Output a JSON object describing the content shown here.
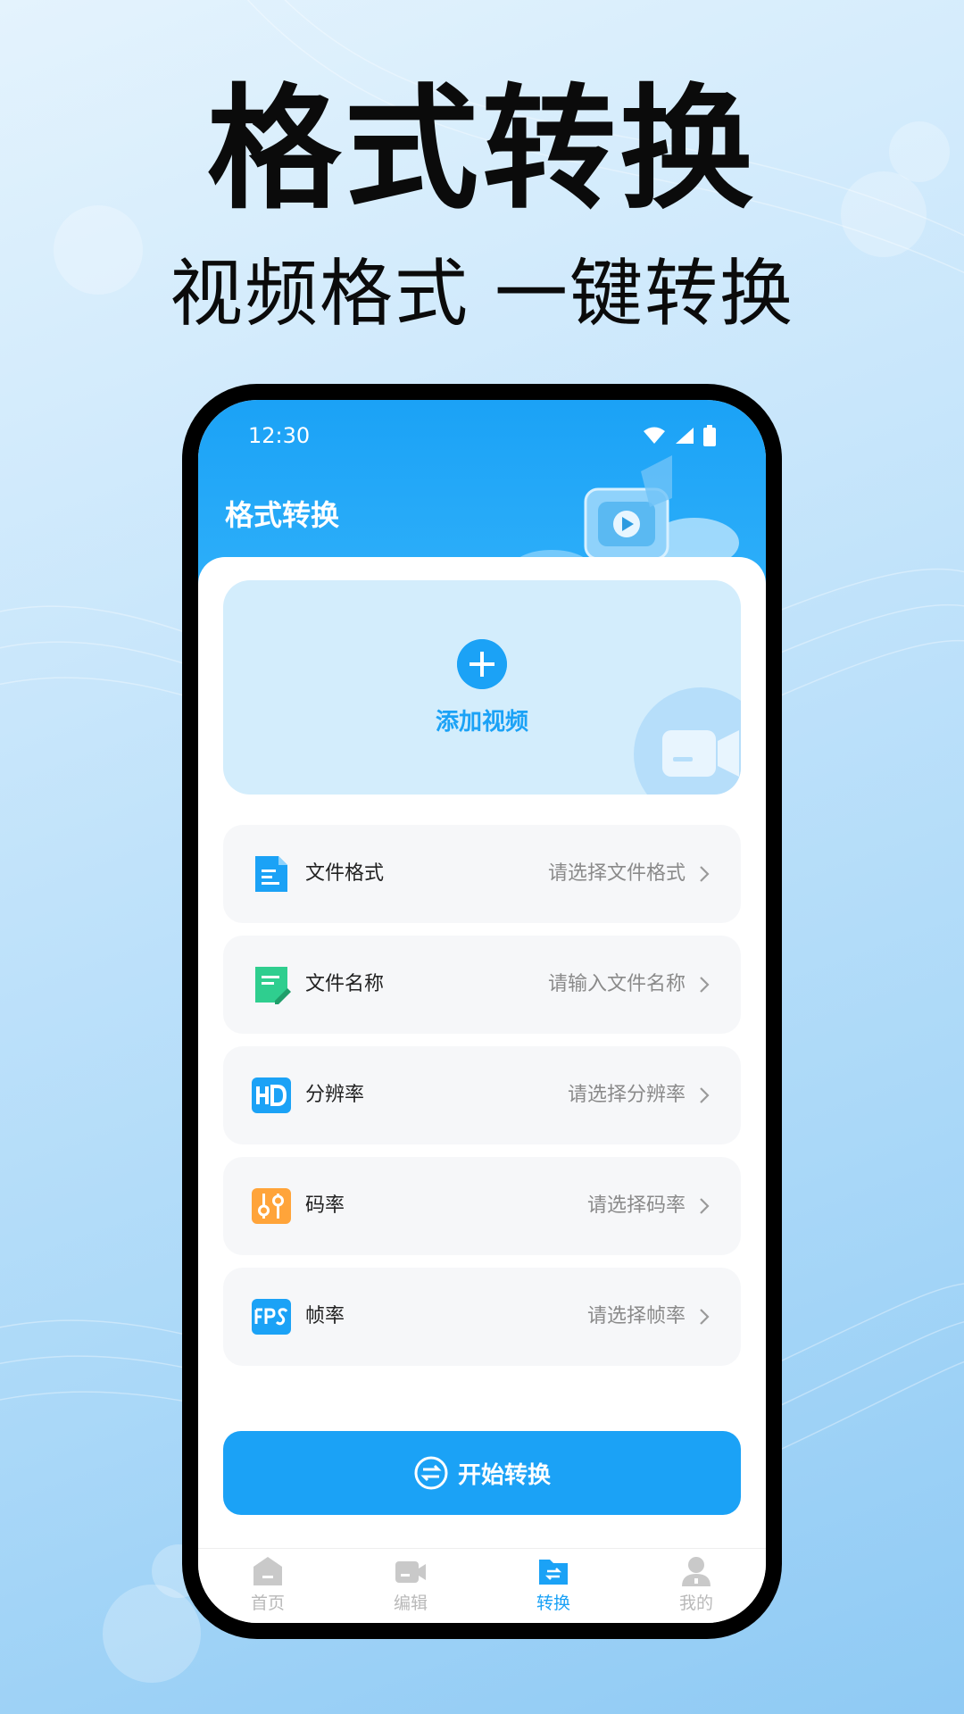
{
  "promo": {
    "title": "格式转换",
    "subtitle": "视频格式 一键转换"
  },
  "status_bar": {
    "time": "12:30"
  },
  "header": {
    "title": "格式转换"
  },
  "add_video": {
    "label": "添加视频"
  },
  "settings": [
    {
      "icon": "document-icon",
      "label": "文件格式",
      "value": "请选择文件格式"
    },
    {
      "icon": "edit-document-icon",
      "label": "文件名称",
      "value": "请输入文件名称"
    },
    {
      "icon": "hd-icon",
      "label": "分辨率",
      "value": "请选择分辨率"
    },
    {
      "icon": "sliders-icon",
      "label": "码率",
      "value": "请选择码率"
    },
    {
      "icon": "fps-icon",
      "label": "帧率",
      "value": "请选择帧率"
    }
  ],
  "start_button": {
    "label": "开始转换"
  },
  "tabbar": {
    "items": [
      {
        "label": "首页",
        "icon": "home-icon",
        "active": false
      },
      {
        "label": "编辑",
        "icon": "video-camera-icon",
        "active": false
      },
      {
        "label": "转换",
        "icon": "convert-folder-icon",
        "active": true
      },
      {
        "label": "我的",
        "icon": "user-icon",
        "active": false
      }
    ]
  },
  "colors": {
    "accent": "#1ba2f6",
    "card_bg": "#d3edfc",
    "row_bg": "#f6f7f9",
    "hint_text": "#8a8a8a",
    "inactive_tab": "#b9b9b9",
    "icon_green": "#2fce8f",
    "icon_orange": "#ffa43a"
  }
}
